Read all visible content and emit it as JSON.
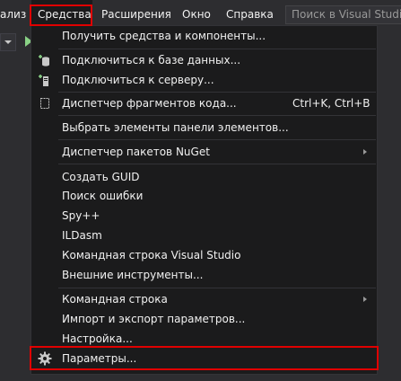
{
  "menubar": {
    "items": [
      "ализ",
      "Средства",
      "Расширения",
      "Окно",
      "Справка"
    ],
    "search_placeholder": "Поиск в Visual Studio"
  },
  "tools_menu": {
    "get_tools": "Получить средства и компоненты...",
    "connect_db": "Подключиться к базе данных...",
    "connect_server": "Подключиться к серверу...",
    "snippets": "Диспетчер фрагментов кода...",
    "snippets_shortcut": "Ctrl+K, Ctrl+B",
    "choose_toolbox": "Выбрать элементы панели элементов...",
    "nuget": "Диспетчер пакетов NuGet",
    "create_guid": "Создать GUID",
    "error_lookup": "Поиск ошибки",
    "spy": "Spy++",
    "ildasm": "ILDasm",
    "vs_cmd": "Командная строка Visual Studio",
    "external_tools": "Внешние инструменты...",
    "command_line": "Командная строка",
    "import_export": "Импорт и экспорт параметров...",
    "customize": "Настройка...",
    "options": "Параметры..."
  },
  "colors": {
    "highlight_border": "#e00000",
    "menu_background": "#1b1b1c",
    "chrome_background": "#2d2d30"
  }
}
